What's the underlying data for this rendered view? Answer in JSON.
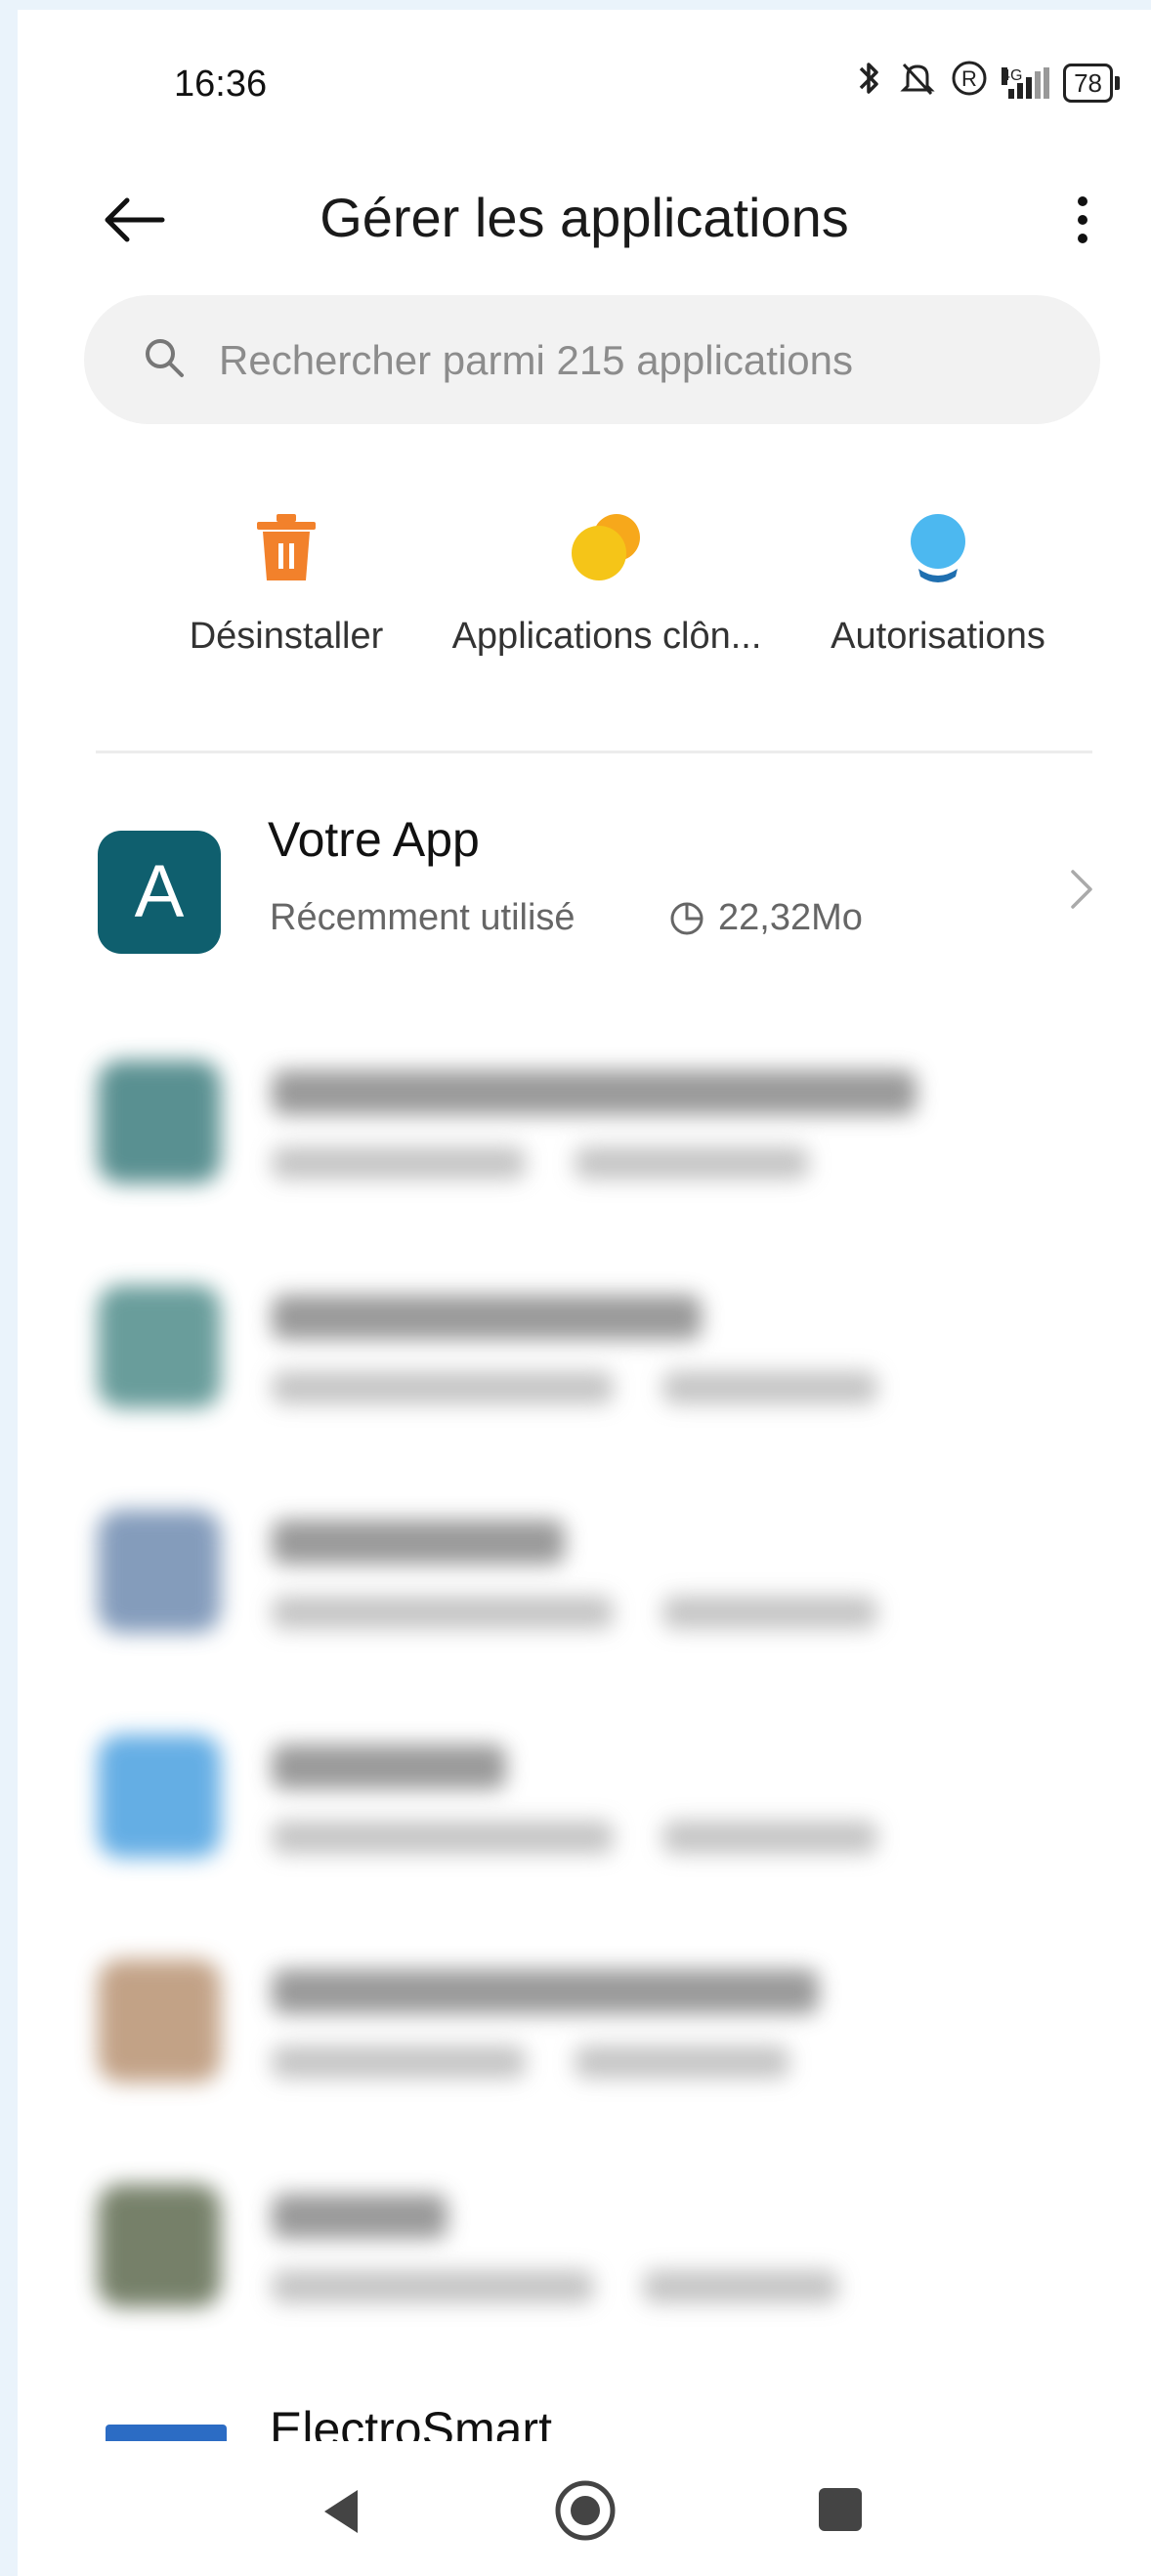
{
  "status_bar": {
    "time": "16:36",
    "network": "4G",
    "battery": "78"
  },
  "header": {
    "title": "Gérer les applications"
  },
  "search": {
    "placeholder": "Rechercher parmi 215 applications"
  },
  "quick_actions": [
    {
      "label": "Désinstaller",
      "icon": "trash-icon",
      "color": "#f2812b"
    },
    {
      "label": "Applications clôn...",
      "icon": "dual-apps-icon",
      "color": "#f5c518"
    },
    {
      "label": "Autorisations",
      "icon": "permissions-icon",
      "color": "#4cb8f0"
    }
  ],
  "apps": [
    {
      "name": "Votre App",
      "status": "Récemment utilisé",
      "size": "22,32Mo",
      "icon_letter": "A",
      "icon_color": "#0f5f6e"
    }
  ],
  "blurred_apps": [
    {
      "icon_color": "#3d7d7e"
    },
    {
      "icon_color": "#4f8c8a"
    },
    {
      "icon_color": "#6f8bb0"
    },
    {
      "icon_color": "#4aa0e0"
    },
    {
      "icon_color": "#b89272"
    },
    {
      "icon_color": "#5f6b50"
    }
  ],
  "partial_app": {
    "name": "ElectroSmart"
  }
}
